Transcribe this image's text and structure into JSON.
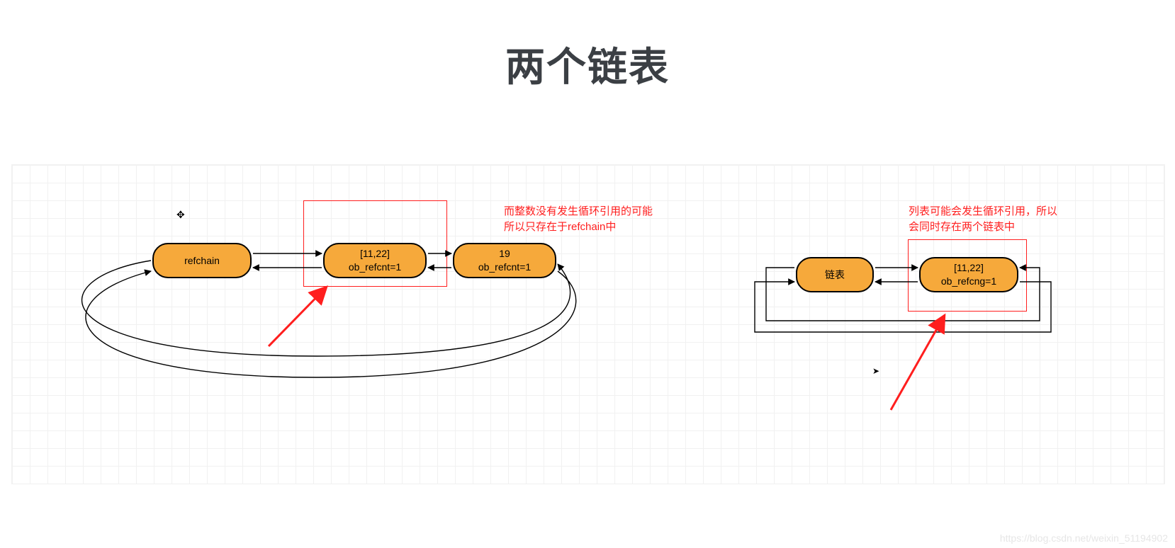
{
  "title": "两个链表",
  "left_chain": {
    "nodes": {
      "a": {
        "label": "refchain"
      },
      "b": {
        "line1": "[11,22]",
        "line2": "ob_refcnt=1"
      },
      "c": {
        "line1": "19",
        "line2": "ob_refcnt=1"
      }
    },
    "annotation": "而整数没有发生循环引用的可能\n所以只存在于refchain中"
  },
  "right_chain": {
    "nodes": {
      "a": {
        "label": "链表"
      },
      "b": {
        "line1": "[11,22]",
        "line2": "ob_refcng=1"
      }
    },
    "annotation": "列表可能会发生循环引用，所以\n会同时存在两个链表中"
  },
  "watermark": "https://blog.csdn.net/weixin_51194902",
  "colors": {
    "node_fill": "#f6a93b",
    "node_stroke": "#000000",
    "annotation": "#ff1e1e",
    "title": "#3b3f44"
  }
}
